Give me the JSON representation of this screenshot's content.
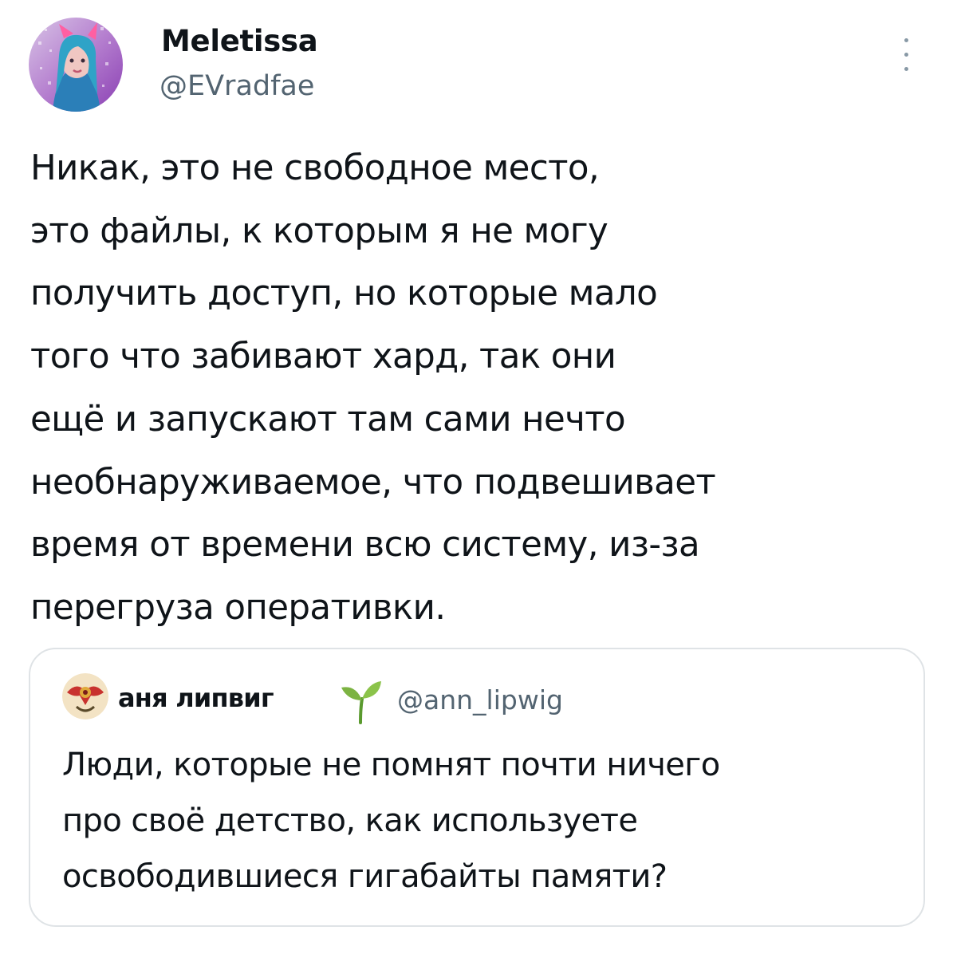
{
  "tweet": {
    "author": {
      "display_name": "Meletissa",
      "handle": "@EVradfae",
      "avatar_icon": "user-avatar-photo"
    },
    "more_icon": "more-vertical-icon",
    "text": "Никак, это не свободное место,\nэто файлы, к которым я не могу\nполучить доступ, но которые мало\nтого что забивают хард, так они\nещё и запускают там сами нечто\nнеобнаруживаемое, что подвешивает\nвремя от времени всю систему, из-за\nперегруза оперативки."
  },
  "quoted_tweet": {
    "author": {
      "display_name": "аня липвиг",
      "handle": "@ann_lipwig",
      "avatar_icon": "user-avatar-emblem",
      "name_emoji": "seedling-icon"
    },
    "text": "Люди, которые не помнят почти ничего\nпро своё детство, как используете\nосвободившиеся гигабайты памяти?"
  },
  "colors": {
    "text_primary": "#0f1419",
    "text_secondary": "#536471",
    "card_border": "#dfe3e6",
    "sprout_green": "#7cb342"
  }
}
